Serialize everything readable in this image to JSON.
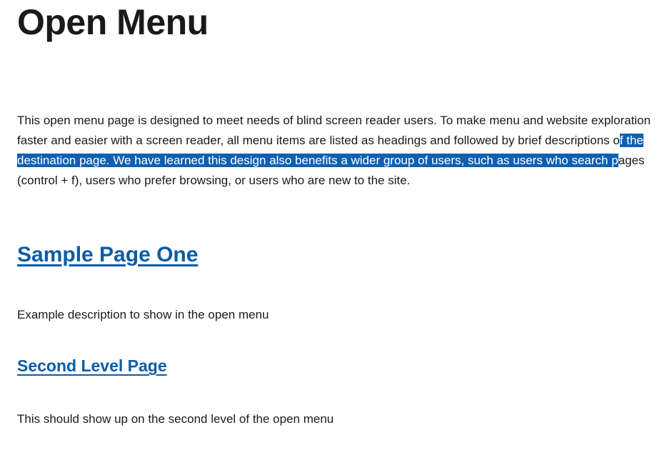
{
  "title": "Open Menu",
  "intro": {
    "pre": "This open menu page is designed to meet needs of blind screen reader users. To make menu and website exploration faster and easier with a screen reader, all menu items are listed as headings and followed by brief descriptions o",
    "selected": "f the destination page. We have learned this design also benefits a wider group of users, such as users who search p",
    "post": "ages (control + f), users who prefer browsing, or users who are new to the site."
  },
  "sections": [
    {
      "heading": "Sample Page One",
      "description": "Example description to show in the open menu"
    },
    {
      "heading": "Second Level Page",
      "description": "This should show up on the second level of the open menu"
    }
  ]
}
